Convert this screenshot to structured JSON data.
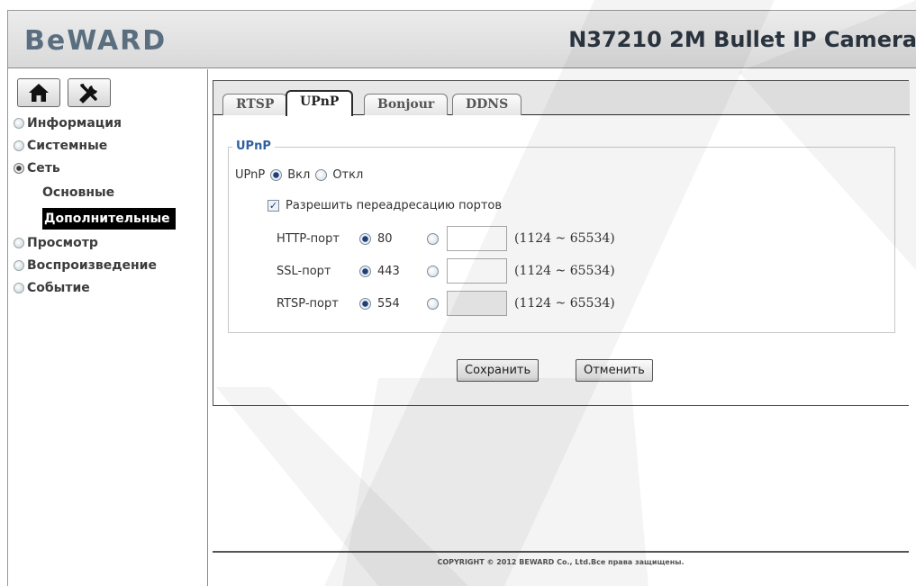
{
  "header": {
    "logo": "BeWARD",
    "model": "N37210 2M Bullet IP Camera"
  },
  "toolbar": {
    "home_icon": "home-icon",
    "settings_icon": "tools-icon"
  },
  "menu": [
    {
      "label": "Информация",
      "active": false
    },
    {
      "label": "Системные",
      "active": false
    },
    {
      "label": "Сеть",
      "active": true
    },
    {
      "label": "Основные",
      "sub": true
    },
    {
      "label": "Дополнительные",
      "sub": true,
      "selected": true
    },
    {
      "label": "Просмотр",
      "active": false
    },
    {
      "label": "Воспроизведение",
      "active": false
    },
    {
      "label": "Событие",
      "active": false
    }
  ],
  "tabs": [
    "RTSP",
    "UPnP",
    "Bonjour",
    "DDNS"
  ],
  "active_tab": "UPnP",
  "upnp": {
    "legend": "UPnP",
    "enable_label": "UPnP",
    "on_label": "Вкл",
    "off_label": "Откл",
    "on_selected": true,
    "port_forward_label": "Разрешить переадресацию портов",
    "port_forward_checked": true,
    "ports": [
      {
        "label": "HTTP-порт",
        "value": "80",
        "range": "(1124 ~ 65534)",
        "input": "",
        "disabled": false
      },
      {
        "label": "SSL-порт",
        "value": "443",
        "range": "(1124 ~ 65534)",
        "input": "",
        "disabled": false
      },
      {
        "label": "RTSP-порт",
        "value": "554",
        "range": "(1124 ~ 65534)",
        "input": "",
        "disabled": true
      }
    ]
  },
  "buttons": {
    "save": "Сохранить",
    "cancel": "Отменить"
  },
  "footer": {
    "copyright": "COPYRIGHT © 2012 BEWARD Co., Ltd.Все права защищены."
  },
  "colors": {
    "legend": "#2f5fa0",
    "radio_selected": "#1f3f7a"
  }
}
